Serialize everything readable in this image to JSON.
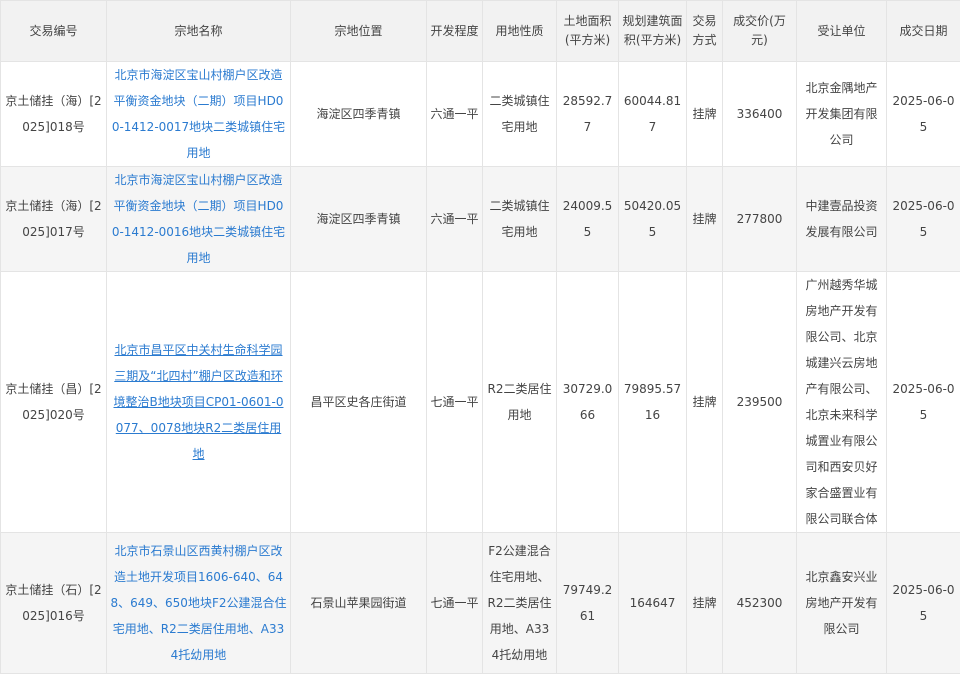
{
  "table": {
    "headers": {
      "trade_id": "交易编号",
      "name": "宗地名称",
      "location": "宗地位置",
      "dev_level": "开发程度",
      "land_use": "用地性质",
      "area": "土地面积(平方米)",
      "build_area": "规划建筑面积(平方米)",
      "trade_method": "交易方式",
      "price": "成交价(万元)",
      "buyer": "受让单位",
      "date": "成交日期"
    },
    "rows": [
      {
        "trade_id": "京土储挂（海）[2025]018号",
        "name": "北京市海淀区宝山村棚户区改造平衡资金地块（二期）项目HD00-1412-0017地块二类城镇住宅用地",
        "location": "海淀区四季青镇",
        "dev_level": "六通一平",
        "land_use": "二类城镇住宅用地",
        "area": "28592.77",
        "build_area": "60044.817",
        "trade_method": "挂牌",
        "price": "336400",
        "buyer": "北京金隅地产开发集团有限公司",
        "date": "2025-06-05"
      },
      {
        "trade_id": "京土储挂（海）[2025]017号",
        "name": "北京市海淀区宝山村棚户区改造平衡资金地块（二期）项目HD00-1412-0016地块二类城镇住宅用地",
        "location": "海淀区四季青镇",
        "dev_level": "六通一平",
        "land_use": "二类城镇住宅用地",
        "area": "24009.55",
        "build_area": "50420.055",
        "trade_method": "挂牌",
        "price": "277800",
        "buyer": "中建壹品投资发展有限公司",
        "date": "2025-06-05"
      },
      {
        "trade_id": "京土储挂（昌）[2025]020号",
        "name": "北京市昌平区中关村生命科学园三期及“北四村”棚户区改造和环境整治B地块项目CP01-0601-0077、0078地块R2二类居住用地",
        "location": "昌平区史各庄街道",
        "dev_level": "七通一平",
        "land_use": "R2二类居住用地",
        "area": "30729.066",
        "build_area": "79895.5716",
        "trade_method": "挂牌",
        "price": "239500",
        "buyer": "广州越秀华城房地产开发有限公司、北京城建兴云房地产有限公司、北京未来科学城置业有限公司和西安贝好家合盛置业有限公司联合体",
        "date": "2025-06-05"
      },
      {
        "trade_id": "京土储挂（石）[2025]016号",
        "name": "北京市石景山区西黄村棚户区改造土地开发项目1606-640、648、649、650地块F2公建混合住宅用地、R2二类居住用地、A334托幼用地",
        "location": "石景山苹果园街道",
        "dev_level": "七通一平",
        "land_use": "F2公建混合住宅用地、R2二类居住用地、A334托幼用地",
        "area": "79749.261",
        "build_area": "164647",
        "trade_method": "挂牌",
        "price": "452300",
        "buyer": "北京鑫安兴业房地产开发有限公司",
        "date": "2025-06-05"
      }
    ]
  }
}
